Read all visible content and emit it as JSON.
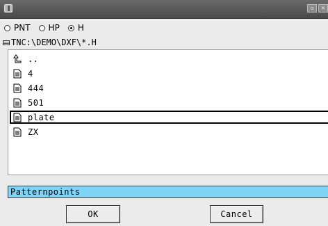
{
  "window": {
    "buttons": [
      "minimize-icon",
      "close-icon"
    ]
  },
  "filter": {
    "options": [
      {
        "label": "PNT",
        "selected": false
      },
      {
        "label": "HP",
        "selected": false
      },
      {
        "label": "H",
        "selected": true
      }
    ]
  },
  "path": "TNC:\\DEMO\\DXF\\*.H",
  "files": [
    {
      "label": "..",
      "icon": "parent-folder-icon",
      "selected": false
    },
    {
      "label": "4",
      "icon": "file-icon",
      "selected": false
    },
    {
      "label": "444",
      "icon": "file-icon",
      "selected": false
    },
    {
      "label": "501",
      "icon": "file-icon",
      "selected": false
    },
    {
      "label": "plate",
      "icon": "file-icon",
      "selected": true
    },
    {
      "label": "ZX",
      "icon": "file-icon",
      "selected": false
    }
  ],
  "name_field": {
    "value": "Patternpoints"
  },
  "buttons": {
    "ok": "OK",
    "cancel": "Cancel"
  },
  "colors": {
    "name_field_bg": "#7fd4f5",
    "dialog_bg": "#ebebeb"
  }
}
